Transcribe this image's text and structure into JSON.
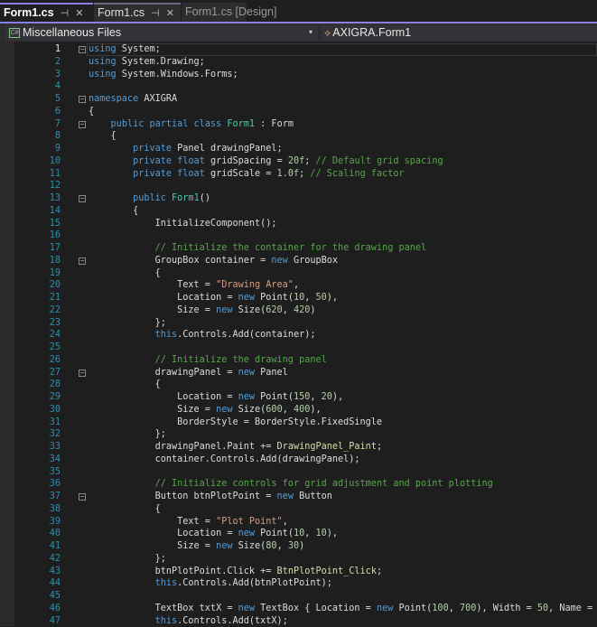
{
  "tabs": [
    {
      "label": "Form1.cs",
      "pin": "⊣",
      "close": "✕",
      "active": true
    },
    {
      "label": "Form1.cs",
      "pin": "⊣",
      "close": "✕"
    },
    {
      "label": "Form1.cs [Design]"
    }
  ],
  "nav": {
    "project": "Miscellaneous Files",
    "project_icon": "C#",
    "member": "AXIGRA.Form1",
    "dropdown": "▾"
  },
  "colors": {
    "keyword": "#569cd6",
    "type": "#4ec9b0",
    "string": "#d69d85",
    "comment": "#57a64a",
    "number": "#b5cea8",
    "accent": "#8a80e8"
  },
  "fold_lines": [
    1,
    5,
    7,
    13,
    18,
    27,
    37
  ],
  "code": {
    "lines": [
      [
        [
          "k",
          "using"
        ],
        [
          "p",
          " System;"
        ]
      ],
      [
        [
          "k",
          "using"
        ],
        [
          "p",
          " System.Drawing;"
        ]
      ],
      [
        [
          "k",
          "using"
        ],
        [
          "p",
          " System.Windows.Forms;"
        ]
      ],
      [],
      [
        [
          "k",
          "namespace"
        ],
        [
          "p",
          " AXIGRA"
        ]
      ],
      [
        [
          "p",
          "{"
        ]
      ],
      [
        [
          "p",
          "    "
        ],
        [
          "k",
          "public partial class"
        ],
        [
          "p",
          " "
        ],
        [
          "t",
          "Form1"
        ],
        [
          "p",
          " : Form"
        ]
      ],
      [
        [
          "p",
          "    {"
        ]
      ],
      [
        [
          "p",
          "        "
        ],
        [
          "k",
          "private"
        ],
        [
          "p",
          " Panel drawingPanel;"
        ]
      ],
      [
        [
          "p",
          "        "
        ],
        [
          "k",
          "private float"
        ],
        [
          "p",
          " gridSpacing = "
        ],
        [
          "n",
          "20f"
        ],
        [
          "p",
          "; "
        ],
        [
          "c",
          "// Default grid spacing"
        ]
      ],
      [
        [
          "p",
          "        "
        ],
        [
          "k",
          "private float"
        ],
        [
          "p",
          " gridScale = "
        ],
        [
          "n",
          "1.0f"
        ],
        [
          "p",
          "; "
        ],
        [
          "c",
          "// Scaling factor"
        ]
      ],
      [],
      [
        [
          "p",
          "        "
        ],
        [
          "k",
          "public"
        ],
        [
          "p",
          " "
        ],
        [
          "t",
          "Form1"
        ],
        [
          "p",
          "()"
        ]
      ],
      [
        [
          "p",
          "        {"
        ]
      ],
      [
        [
          "p",
          "            InitializeComponent();"
        ]
      ],
      [],
      [
        [
          "p",
          "            "
        ],
        [
          "c",
          "// Initialize the container for the drawing panel"
        ]
      ],
      [
        [
          "p",
          "            GroupBox container = "
        ],
        [
          "k",
          "new"
        ],
        [
          "p",
          " GroupBox"
        ]
      ],
      [
        [
          "p",
          "            {"
        ]
      ],
      [
        [
          "p",
          "                Text = "
        ],
        [
          "s",
          "\"Drawing Area\""
        ],
        [
          "p",
          ","
        ]
      ],
      [
        [
          "p",
          "                Location = "
        ],
        [
          "k",
          "new"
        ],
        [
          "p",
          " Point("
        ],
        [
          "n",
          "10"
        ],
        [
          "p",
          ", "
        ],
        [
          "n",
          "50"
        ],
        [
          "p",
          "),"
        ]
      ],
      [
        [
          "p",
          "                Size = "
        ],
        [
          "k",
          "new"
        ],
        [
          "p",
          " Size("
        ],
        [
          "n",
          "620"
        ],
        [
          "p",
          ", "
        ],
        [
          "n",
          "420"
        ],
        [
          "p",
          ")"
        ]
      ],
      [
        [
          "p",
          "            };"
        ]
      ],
      [
        [
          "p",
          "            "
        ],
        [
          "k",
          "this"
        ],
        [
          "p",
          ".Controls.Add(container);"
        ]
      ],
      [],
      [
        [
          "p",
          "            "
        ],
        [
          "c",
          "// Initialize the drawing panel"
        ]
      ],
      [
        [
          "p",
          "            drawingPanel = "
        ],
        [
          "k",
          "new"
        ],
        [
          "p",
          " Panel"
        ]
      ],
      [
        [
          "p",
          "            {"
        ]
      ],
      [
        [
          "p",
          "                Location = "
        ],
        [
          "k",
          "new"
        ],
        [
          "p",
          " Point("
        ],
        [
          "n",
          "150"
        ],
        [
          "p",
          ", "
        ],
        [
          "n",
          "20"
        ],
        [
          "p",
          "),"
        ]
      ],
      [
        [
          "p",
          "                Size = "
        ],
        [
          "k",
          "new"
        ],
        [
          "p",
          " Size("
        ],
        [
          "n",
          "600"
        ],
        [
          "p",
          ", "
        ],
        [
          "n",
          "400"
        ],
        [
          "p",
          "),"
        ]
      ],
      [
        [
          "p",
          "                BorderStyle = BorderStyle.FixedSingle"
        ]
      ],
      [
        [
          "p",
          "            };"
        ]
      ],
      [
        [
          "p",
          "            drawingPanel.Paint += "
        ],
        [
          "m",
          "DrawingPanel_Paint"
        ],
        [
          "p",
          ";"
        ]
      ],
      [
        [
          "p",
          "            container.Controls.Add(drawingPanel);"
        ]
      ],
      [],
      [
        [
          "p",
          "            "
        ],
        [
          "c",
          "// Initialize controls for grid adjustment and point plotting"
        ]
      ],
      [
        [
          "p",
          "            Button btnPlotPoint = "
        ],
        [
          "k",
          "new"
        ],
        [
          "p",
          " Button"
        ]
      ],
      [
        [
          "p",
          "            {"
        ]
      ],
      [
        [
          "p",
          "                Text = "
        ],
        [
          "s",
          "\"Plot Point\""
        ],
        [
          "p",
          ","
        ]
      ],
      [
        [
          "p",
          "                Location = "
        ],
        [
          "k",
          "new"
        ],
        [
          "p",
          " Point("
        ],
        [
          "n",
          "10"
        ],
        [
          "p",
          ", "
        ],
        [
          "n",
          "10"
        ],
        [
          "p",
          "),"
        ]
      ],
      [
        [
          "p",
          "                Size = "
        ],
        [
          "k",
          "new"
        ],
        [
          "p",
          " Size("
        ],
        [
          "n",
          "80"
        ],
        [
          "p",
          ", "
        ],
        [
          "n",
          "30"
        ],
        [
          "p",
          ")"
        ]
      ],
      [
        [
          "p",
          "            };"
        ]
      ],
      [
        [
          "p",
          "            btnPlotPoint.Click += "
        ],
        [
          "m",
          "BtnPlotPoint_Click"
        ],
        [
          "p",
          ";"
        ]
      ],
      [
        [
          "p",
          "            "
        ],
        [
          "k",
          "this"
        ],
        [
          "p",
          ".Controls.Add(btnPlotPoint);"
        ]
      ],
      [],
      [
        [
          "p",
          "            TextBox txtX = "
        ],
        [
          "k",
          "new"
        ],
        [
          "p",
          " TextBox { Location = "
        ],
        [
          "k",
          "new"
        ],
        [
          "p",
          " Point("
        ],
        [
          "n",
          "100"
        ],
        [
          "p",
          ", "
        ],
        [
          "n",
          "700"
        ],
        [
          "p",
          "), Width = "
        ],
        [
          "n",
          "50"
        ],
        [
          "p",
          ", Name = "
        ]
      ],
      [
        [
          "p",
          "            "
        ],
        [
          "k",
          "this"
        ],
        [
          "p",
          ".Controls.Add(txtX);"
        ]
      ]
    ]
  }
}
